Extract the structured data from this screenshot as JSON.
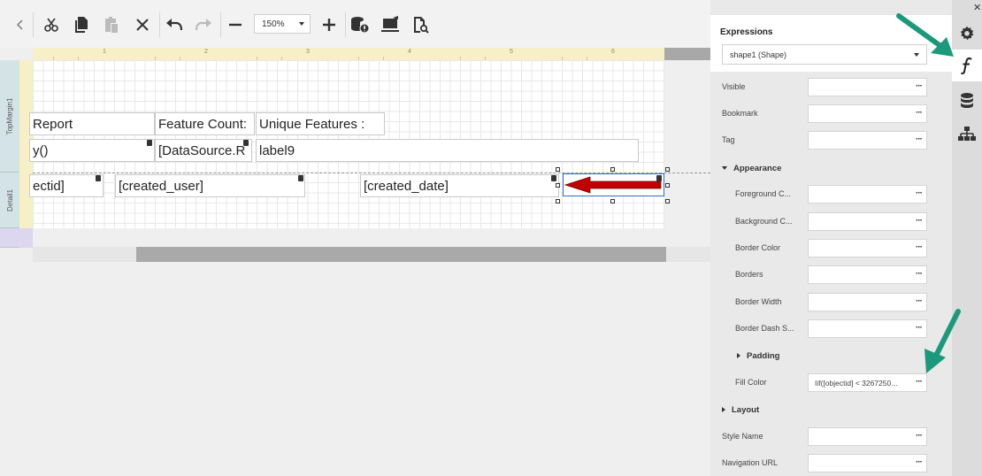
{
  "toolbar": {
    "zoom_value": "150%"
  },
  "ruler": {
    "numbers": [
      "1",
      "2",
      "3",
      "4",
      "5",
      "6"
    ]
  },
  "bands": {
    "top_margin": "TopMargin1",
    "detail": "Detail1"
  },
  "report_cells": {
    "report_title": "Report",
    "feature_count_label": "Feature Count:",
    "unique_features_label": "Unique Features :",
    "func_call": "y()",
    "datasource_expr": "[DataSource.R",
    "label9": "label9",
    "objectid_field": "ectid]",
    "created_user_field": "[created_user]",
    "created_date_field": "[created_date]"
  },
  "panel": {
    "title": "Expressions",
    "selected_object": "shape1 (Shape)",
    "ellipsis": "···",
    "properties": {
      "visible": "Visible",
      "bookmark": "Bookmark",
      "tag": "Tag",
      "appearance": "Appearance",
      "foreground_color": "Foreground C...",
      "background_color": "Background C...",
      "border_color": "Border Color",
      "borders": "Borders",
      "border_width": "Border Width",
      "border_dash_style": "Border Dash S...",
      "padding": "Padding",
      "fill_color": "Fill Color",
      "fill_color_value": "Iif([objectid] < 3267250...",
      "layout": "Layout",
      "style_name": "Style Name",
      "navigation_url": "Navigation URL"
    }
  },
  "colors": {
    "annotation_arrow": "#1a9a7a",
    "shape_arrow": "#c00000",
    "ruler": "#f7f0c6",
    "selection": "#2f6fba"
  }
}
